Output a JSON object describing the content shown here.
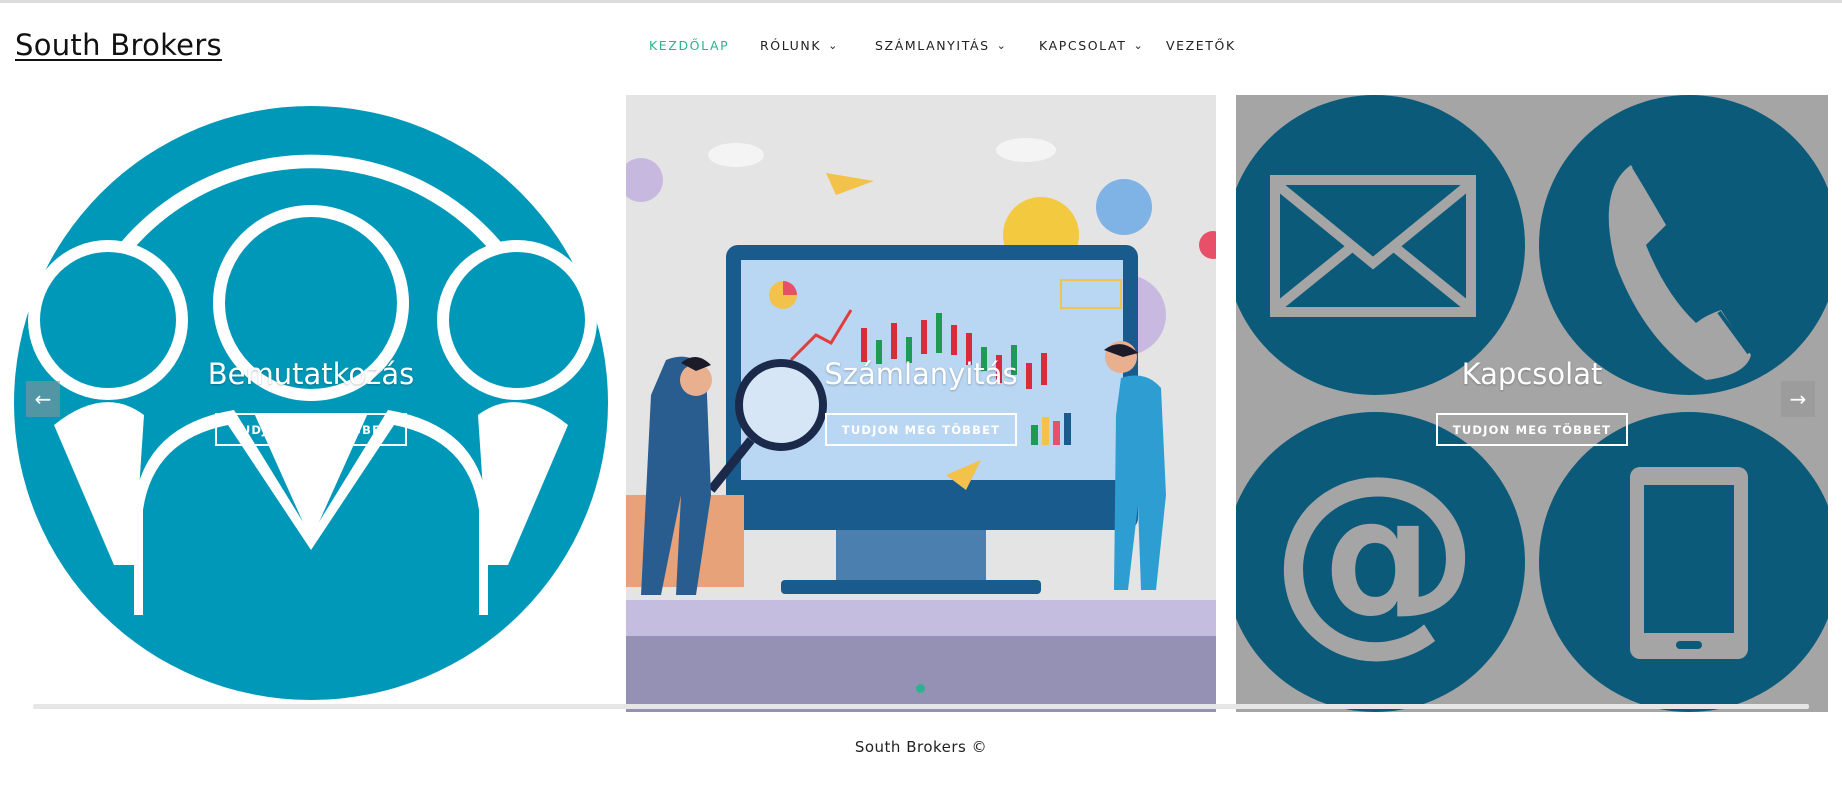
{
  "site": {
    "logo": "South Brokers"
  },
  "nav": {
    "items": [
      {
        "label": "KEZDŐLAP",
        "active": true,
        "dropdown": false
      },
      {
        "label": "RÓLUNK",
        "active": false,
        "dropdown": true
      },
      {
        "label": "SZÁMLANYITÁS",
        "active": false,
        "dropdown": true
      },
      {
        "label": "KAPCSOLAT",
        "active": false,
        "dropdown": true
      },
      {
        "label": "VEZETŐK",
        "active": false,
        "dropdown": false
      }
    ]
  },
  "slider": {
    "slides": [
      {
        "title": "Bemutatkozás",
        "button": "TUDJON MEG TÖBBET",
        "image": "people-group-icon"
      },
      {
        "title": "Számlanyitás",
        "button": "TUDJON MEG TÖBBET",
        "image": "trading-analysis-illustration"
      },
      {
        "title": "Kapcsolat",
        "button": "TUDJON MEG TÖBBET",
        "image": "contact-icons-grid"
      }
    ],
    "prev_icon": "arrow-left-icon",
    "next_icon": "arrow-right-icon",
    "active_dot": 1
  },
  "footer": {
    "text": "South Brokers ©"
  },
  "colors": {
    "accent": "#2bb38f",
    "people_blue": "#0098b8",
    "contact_blue": "#0b5a7a",
    "contact_bg": "#a5a5a5"
  }
}
